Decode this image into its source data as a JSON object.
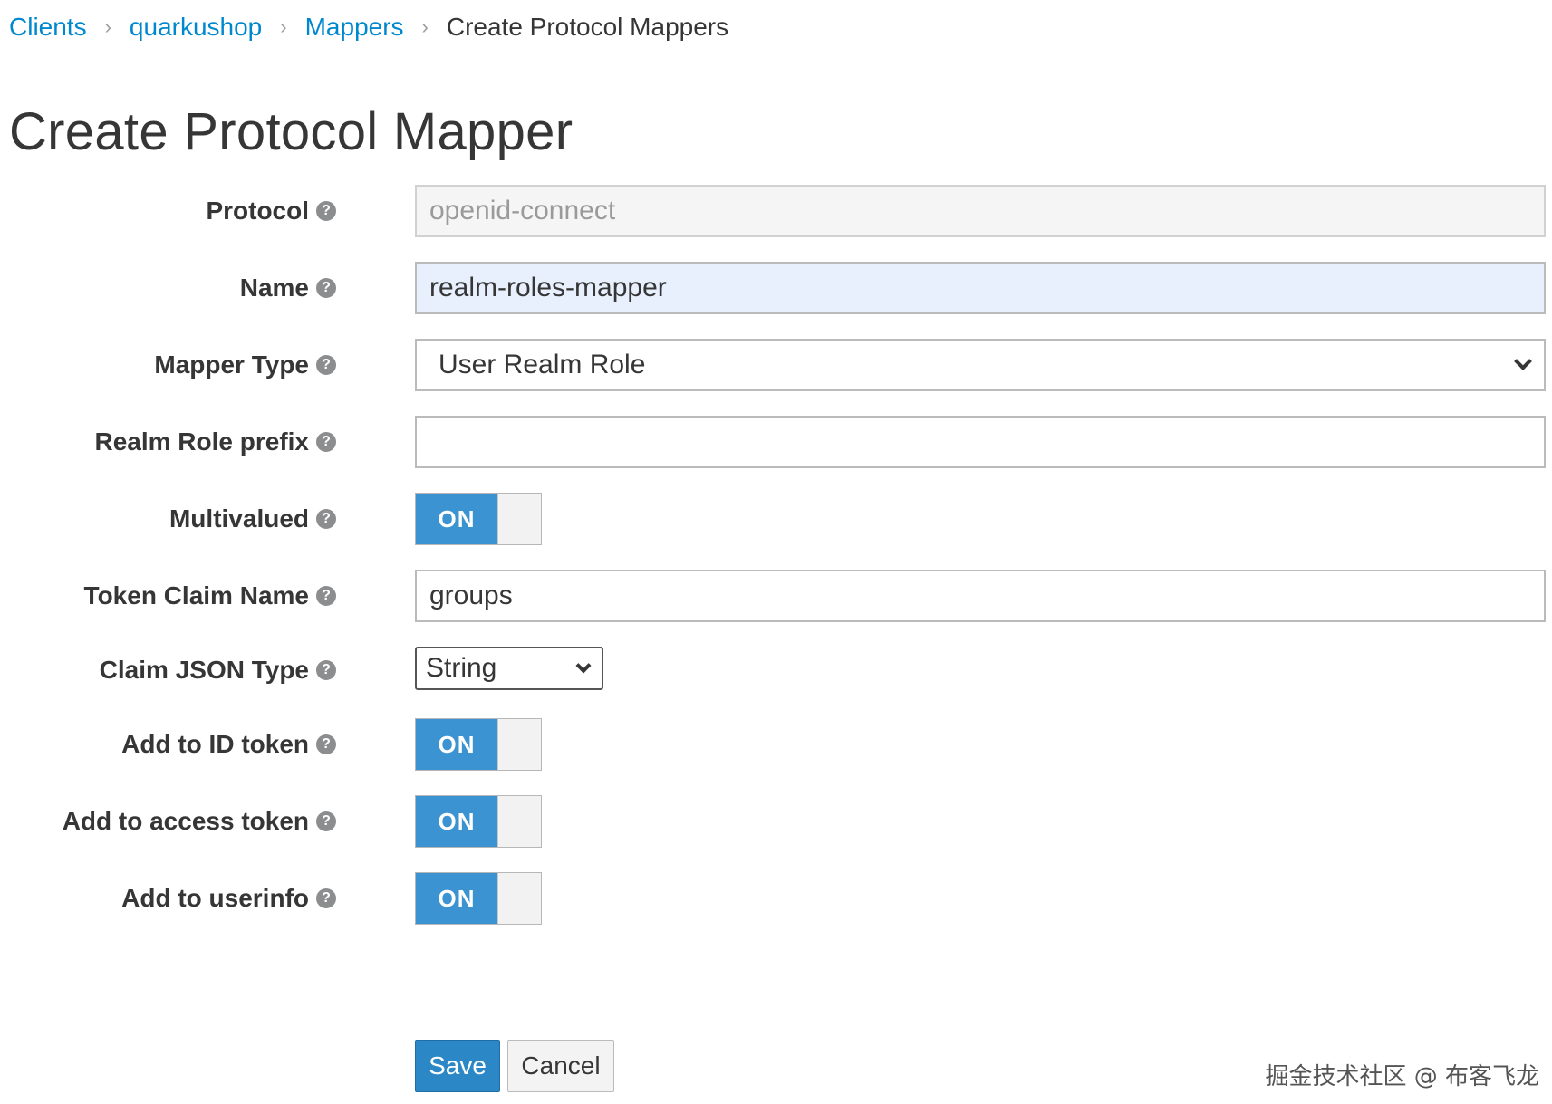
{
  "breadcrumb": {
    "items": [
      "Clients",
      "quarkushop",
      "Mappers"
    ],
    "separator": "›",
    "current": "Create Protocol Mappers"
  },
  "page": {
    "title": "Create Protocol Mapper"
  },
  "form": {
    "help_icon": "?",
    "protocol": {
      "label": "Protocol",
      "value": "openid-connect"
    },
    "name": {
      "label": "Name",
      "value": "realm-roles-mapper"
    },
    "mapper_type": {
      "label": "Mapper Type",
      "value": "User Realm Role"
    },
    "realm_role_prefix": {
      "label": "Realm Role prefix",
      "value": ""
    },
    "multivalued": {
      "label": "Multivalued",
      "state": "ON"
    },
    "token_claim_name": {
      "label": "Token Claim Name",
      "value": "groups"
    },
    "claim_json_type": {
      "label": "Claim JSON Type",
      "value": "String"
    },
    "add_to_id_token": {
      "label": "Add to ID token",
      "state": "ON"
    },
    "add_to_access_token": {
      "label": "Add to access token",
      "state": "ON"
    },
    "add_to_userinfo": {
      "label": "Add to userinfo",
      "state": "ON"
    }
  },
  "actions": {
    "save_label": "Save",
    "cancel_label": "Cancel"
  },
  "watermark": "掘金技术社区 @ 布客飞龙",
  "colors": {
    "link": "#0088ce",
    "switch_on": "#3b94d1",
    "primary_button": "#2c87c6"
  }
}
